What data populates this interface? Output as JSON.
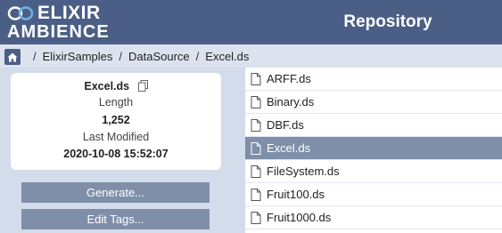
{
  "header": {
    "logo_line1": "ELIXIR",
    "logo_line2": "AMBIENCE",
    "title": "Repository"
  },
  "breadcrumb": {
    "items": [
      "ElixirSamples",
      "DataSource",
      "Excel.ds"
    ],
    "separator": "/"
  },
  "details": {
    "name": "Excel.ds",
    "length_label": "Length",
    "length_value": "1,252",
    "modified_label": "Last Modified",
    "modified_value": "2020-10-08 15:52:07"
  },
  "actions": {
    "generate": "Generate...",
    "edit_tags": "Edit Tags..."
  },
  "files": [
    {
      "name": "ARFF.ds",
      "selected": false
    },
    {
      "name": "Binary.ds",
      "selected": false
    },
    {
      "name": "DBF.ds",
      "selected": false
    },
    {
      "name": "Excel.ds",
      "selected": true
    },
    {
      "name": "FileSystem.ds",
      "selected": false
    },
    {
      "name": "Fruit100.ds",
      "selected": false
    },
    {
      "name": "Fruit1000.ds",
      "selected": false
    }
  ],
  "colors": {
    "header_bg": "#4b5f86",
    "selected_row": "#7f8fa9",
    "page_bg": "#d3dcea"
  }
}
